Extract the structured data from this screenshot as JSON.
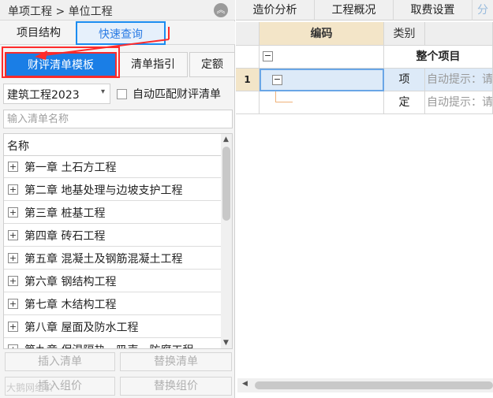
{
  "breadcrumb": "单项工程 > 单位工程",
  "collapse_icon": "double-chevron-up-icon",
  "nav_tabs": [
    "项目结构",
    "快速查询"
  ],
  "sub_tabs": [
    "财评清单模板",
    "清单指引",
    "定额"
  ],
  "filter": {
    "select_value": "建筑工程2023",
    "auto_match_label": "自动匹配财评清单"
  },
  "search": {
    "placeholder": "输入清单名称"
  },
  "tree": {
    "header": "名称",
    "items": [
      "第一章  土石方工程",
      "第二章  地基处理与边坡支护工程",
      "第三章  桩基工程",
      "第四章    砖石工程",
      "第五章    混凝土及钢筋混凝土工程",
      "第六章    钢结构工程",
      "第七章    木结构工程",
      "第八章    屋面及防水工程",
      "第九章    保温隔热、吸声、防腐工程"
    ]
  },
  "buttons": {
    "insert_list": "插入清单",
    "replace_list": "替换清单",
    "insert_group": "插入组价",
    "replace_group": "替换组价"
  },
  "watermark": "大鹅网组价",
  "right_tabs": [
    "造价分析",
    "工程概况",
    "取费设置",
    "分"
  ],
  "grid": {
    "col_code": "编码",
    "col_type": "类别",
    "root_name": "整个项目",
    "rows": [
      {
        "num": "1",
        "type": "项",
        "name": "自动提示：请"
      },
      {
        "num": "",
        "type": "定",
        "name": "自动提示：请"
      }
    ]
  },
  "colors": {
    "accent_blue": "#1a7ee6",
    "highlight_red": "#ff2b2b",
    "header_tan": "#f3e5c8"
  }
}
